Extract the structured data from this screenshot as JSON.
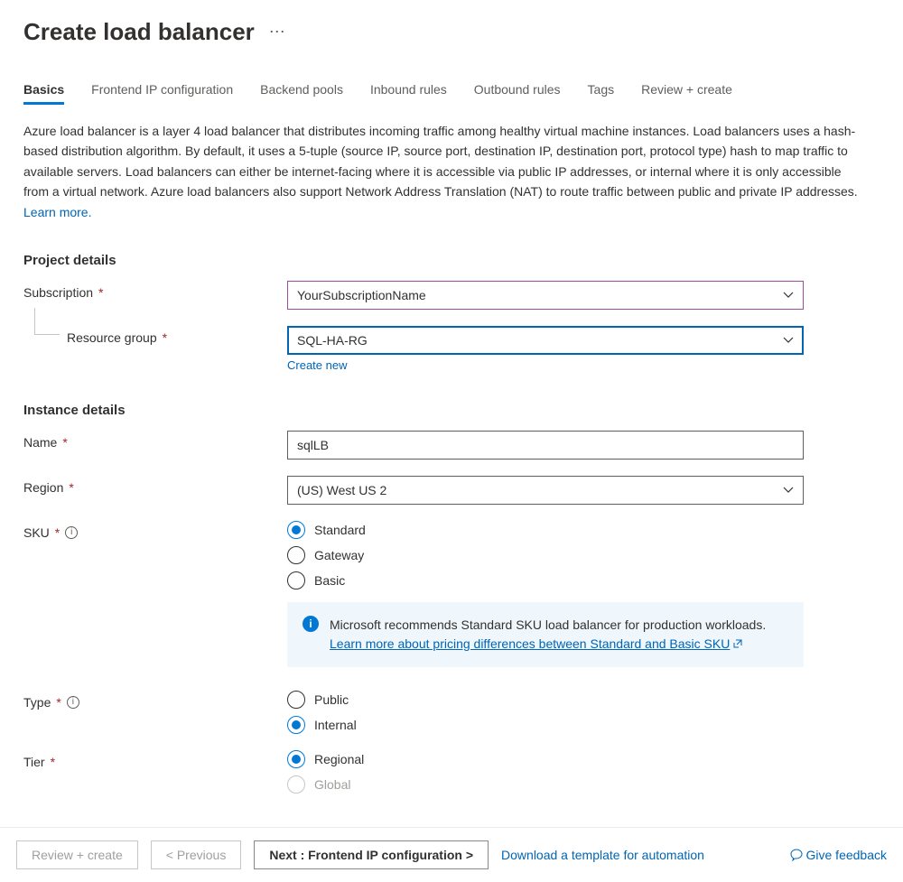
{
  "header": {
    "title": "Create load balancer",
    "more_icon": "⋯"
  },
  "tabs": [
    {
      "label": "Basics",
      "active": true
    },
    {
      "label": "Frontend IP configuration",
      "active": false
    },
    {
      "label": "Backend pools",
      "active": false
    },
    {
      "label": "Inbound rules",
      "active": false
    },
    {
      "label": "Outbound rules",
      "active": false
    },
    {
      "label": "Tags",
      "active": false
    },
    {
      "label": "Review + create",
      "active": false
    }
  ],
  "description": {
    "text": "Azure load balancer is a layer 4 load balancer that distributes incoming traffic among healthy virtual machine instances. Load balancers uses a hash-based distribution algorithm. By default, it uses a 5-tuple (source IP, source port, destination IP, destination port, protocol type) hash to map traffic to available servers. Load balancers can either be internet-facing where it is accessible via public IP addresses, or internal where it is only accessible from a virtual network. Azure load balancers also support Network Address Translation (NAT) to route traffic between public and private IP addresses.  ",
    "learn_more": "Learn more."
  },
  "sections": {
    "project": {
      "heading": "Project details",
      "subscription_label": "Subscription",
      "subscription_value": "YourSubscriptionName",
      "resource_group_label": "Resource group",
      "resource_group_value": "SQL-HA-RG",
      "create_new": "Create new"
    },
    "instance": {
      "heading": "Instance details",
      "name_label": "Name",
      "name_value": "sqlLB",
      "region_label": "Region",
      "region_value": "(US) West US 2",
      "sku_label": "SKU",
      "sku_options": [
        {
          "label": "Standard",
          "selected": true
        },
        {
          "label": "Gateway",
          "selected": false
        },
        {
          "label": "Basic",
          "selected": false
        }
      ],
      "sku_info_text": "Microsoft recommends Standard SKU load balancer for production workloads.",
      "sku_info_link": "Learn more about pricing differences between Standard and Basic SKU",
      "type_label": "Type",
      "type_options": [
        {
          "label": "Public",
          "selected": false
        },
        {
          "label": "Internal",
          "selected": true
        }
      ],
      "tier_label": "Tier",
      "tier_options": [
        {
          "label": "Regional",
          "selected": true,
          "disabled": false
        },
        {
          "label": "Global",
          "selected": false,
          "disabled": true
        }
      ]
    }
  },
  "footer": {
    "review_create": "Review + create",
    "previous": "< Previous",
    "next": "Next : Frontend IP configuration >",
    "download_template": "Download a template for automation",
    "give_feedback": "Give feedback"
  }
}
